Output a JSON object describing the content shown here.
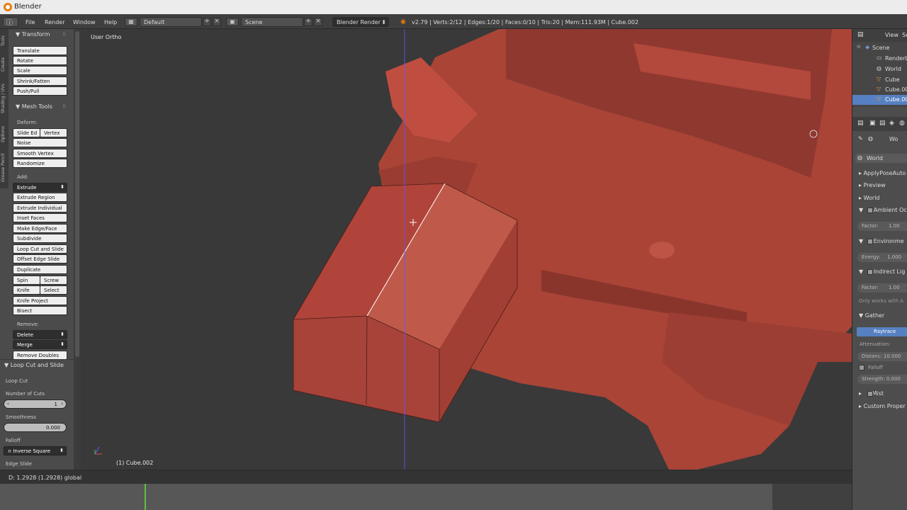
{
  "window": {
    "title": "Blender"
  },
  "menu": {
    "items": [
      "File",
      "Render",
      "Window",
      "Help"
    ],
    "layout": "Default",
    "scene": "Scene",
    "engine": "Blender Render",
    "stats": "v2.79 | Verts:2/12 | Edges:1/20 | Faces:0/10 | Tris:20 | Mem:111.93M | Cube.002"
  },
  "toolshelf": {
    "tabs": [
      "Tools",
      "Create",
      "Shading / UVs",
      "Options",
      "Grease Pencil"
    ],
    "transform_header": "Transform",
    "transform": [
      "Translate",
      "Rotate",
      "Scale",
      "Shrink/Fatten",
      "Push/Pull"
    ],
    "mesh_header": "Mesh Tools",
    "deform_label": "Deform:",
    "slide_edge": "Slide Ed",
    "vertex": "Vertex",
    "noise": "Noise",
    "smooth_vertex": "Smooth Vertex",
    "randomize": "Randomize",
    "add_label": "Add:",
    "extrude": "Extrude",
    "extrude_region": "Extrude Region",
    "extrude_individual": "Extrude Individual",
    "inset_faces": "Inset Faces",
    "make_edge_face": "Make Edge/Face",
    "subdivide": "Subdivide",
    "loop_cut": "Loop Cut and Slide",
    "offset_edge": "Offset Edge Slide",
    "duplicate": "Duplicate",
    "spin": "Spin",
    "screw": "Screw",
    "knife": "Knife",
    "select": "Select",
    "knife_project": "Knife Project",
    "bisect": "Bisect",
    "remove_label": "Remove:",
    "delete": "Delete",
    "merge": "Merge",
    "remove_doubles": "Remove Doubles"
  },
  "operator": {
    "header": "Loop Cut and Slide",
    "loop_cut_label": "Loop Cut",
    "cuts_label": "Number of Cuts",
    "cuts_value": "1",
    "smoothness_label": "Smoothness",
    "smoothness_value": "0.000",
    "falloff_label": "Falloff",
    "falloff_value": "Inverse Square",
    "edge_slide_label": "Edge Slide"
  },
  "viewport": {
    "view_label": "User Ortho",
    "object_label": "(1) Cube.002"
  },
  "status": {
    "text": "D: 1.2928 (1.2928) global"
  },
  "outliner": {
    "view_label": "View",
    "search_label": "Se",
    "items": [
      "Scene",
      "RenderL",
      "World",
      "Cube",
      "Cube.00",
      "Cube.00"
    ]
  },
  "properties": {
    "world_name": "World",
    "world_short": "Wo",
    "panels": [
      "ApplyPoseAuto",
      "Preview",
      "World",
      "Ambient Oc",
      "Environme",
      "Indirect Lig",
      "Gather",
      "Mist",
      "Custom Proper"
    ],
    "factor_label": "Factor:",
    "factor_value": "1.00",
    "energy_label": "Energy:",
    "energy_value": "1.000",
    "factor2_value": "1.00",
    "only_works": "Only works with A",
    "raytrace": "Raytrace",
    "attenuation": "Attenuation:",
    "distance": "Distanc: 10.000",
    "falloff": "Falloff",
    "strength": "Strength: 0.000"
  },
  "colors": {
    "mesh": "#b34a3e",
    "accent": "#5680c2",
    "timeline_cursor": "#60c040"
  }
}
